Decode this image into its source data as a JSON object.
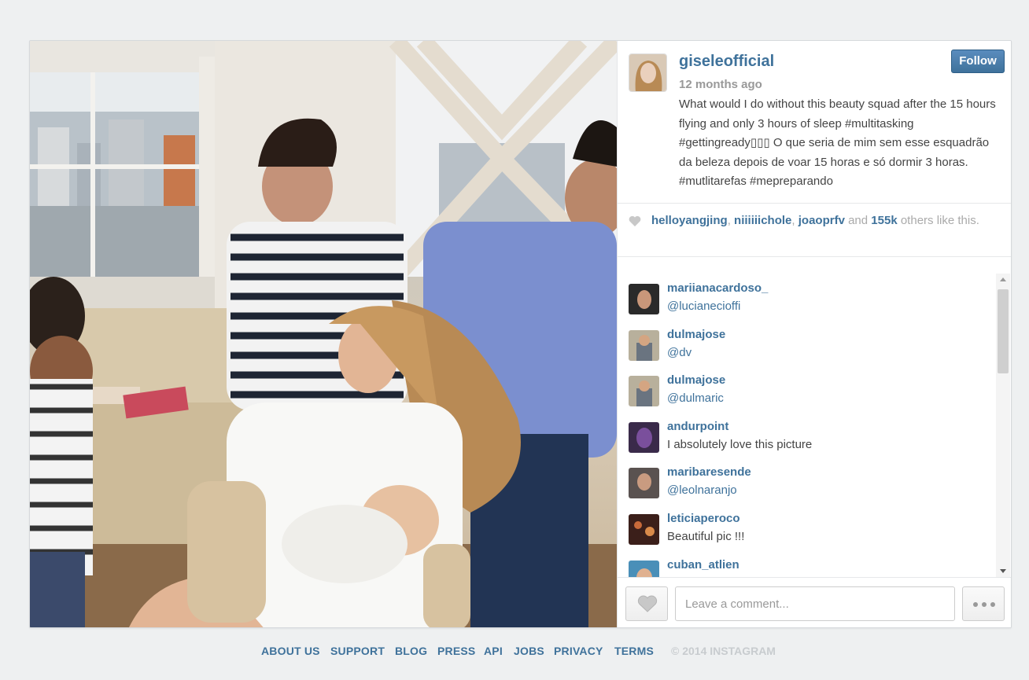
{
  "post": {
    "photo_alt": "",
    "username": "giseleofficial",
    "time": "12 months ago",
    "follow_label": "Follow",
    "caption": "What would I do without this beauty squad after the 15 hours flying and only 3 hours of sleep #multitasking #gettingready▯▯▯ O que seria de mim sem esse esquadrão da beleza depois de voar 15 horas e só dormir 3 horas. #mutlitarefas #mepreparando"
  },
  "likes": {
    "users": [
      "helloyangjing",
      "niiiiiichole",
      "joaoprfv"
    ],
    "and": "and",
    "count": "155k",
    "suffix": "others like this."
  },
  "comments": [
    {
      "user": "mariianacardoso_",
      "text": "@lucianecioffi",
      "mention": true
    },
    {
      "user": "dulmajose",
      "text": "@dv",
      "mention": true
    },
    {
      "user": "dulmajose",
      "text": "@dulmaric",
      "mention": true
    },
    {
      "user": "andurpoint",
      "text": "I absolutely love this picture",
      "mention": false
    },
    {
      "user": "maribaresende",
      "text": "@leolnaranjo",
      "mention": true
    },
    {
      "user": "leticiaperoco",
      "text": "Beautiful pic !!!",
      "mention": false
    },
    {
      "user": "cuban_atlien",
      "text": "",
      "mention": false
    }
  ],
  "comment_box": {
    "placeholder": "Leave a comment..."
  },
  "footer": {
    "links": [
      "ABOUT US",
      "SUPPORT",
      "BLOG",
      "PRESS",
      "API",
      "JOBS",
      "PRIVACY",
      "TERMS"
    ],
    "copyright": "© 2014 INSTAGRAM"
  },
  "colors": {
    "link": "#3f729b",
    "follow_button": "#3f729b",
    "background": "#eef0f1"
  }
}
